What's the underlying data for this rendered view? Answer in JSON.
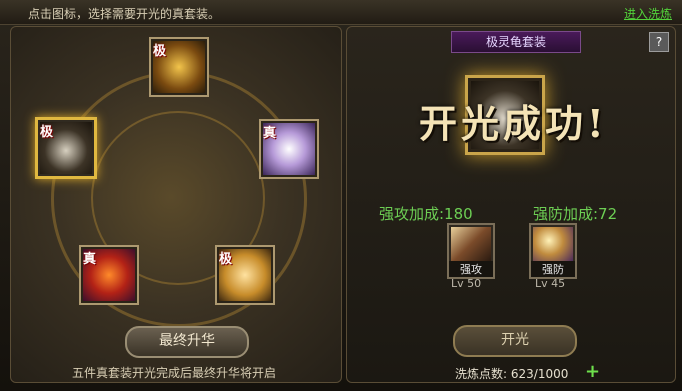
{
  "header": {
    "hint": "点击图标，选择需要开光的真套装。",
    "enter_link": "进入洗炼"
  },
  "left": {
    "slots": [
      {
        "tag": "极",
        "icon": "dragon-armor-icon"
      },
      {
        "tag": "极",
        "icon": "beast-helm-icon"
      },
      {
        "tag": "真",
        "icon": "white-tiger-icon"
      },
      {
        "tag": "真",
        "icon": "phoenix-icon"
      },
      {
        "tag": "极",
        "icon": "golden-dragon-icon"
      }
    ],
    "final_button": "最终升华",
    "note": "五件真套装开光完成后最终升华将开启"
  },
  "right": {
    "set_title": "极灵龟套装",
    "help": "?",
    "success_text": "开光成功!",
    "attack_bonus": "强攻加成:180",
    "defense_bonus": "强防加成:72",
    "skills": [
      {
        "name": "强攻",
        "level": "Lv 50"
      },
      {
        "name": "强防",
        "level": "Lv 45"
      }
    ],
    "open_button": "开光",
    "points_label": "洗炼点数:",
    "points_value": "623/1000",
    "plus": "+"
  },
  "colors": {
    "accent_gold": "#e0b840",
    "bonus_green": "#6dce54",
    "link_green": "#52d23a"
  }
}
